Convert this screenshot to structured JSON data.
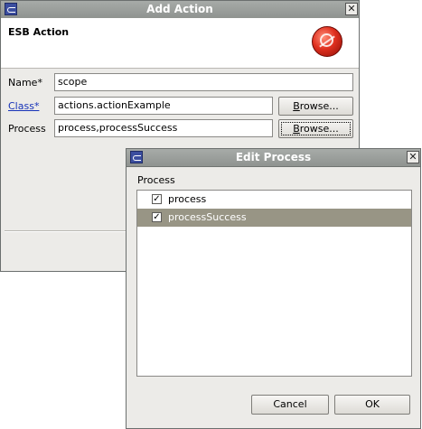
{
  "add_action": {
    "title": "Add Action",
    "close_glyph": "✕",
    "header_title": "ESB Action",
    "fields": {
      "name": {
        "label": "Name*",
        "value": "scope"
      },
      "class": {
        "label": "Class*",
        "value": "actions.actionExample",
        "browse_label": "Browse..."
      },
      "process": {
        "label": "Process",
        "value": "process,processSuccess",
        "browse_label": "Browse..."
      }
    }
  },
  "edit_process": {
    "title": "Edit Process",
    "close_glyph": "✕",
    "section_label": "Process",
    "items": [
      {
        "label": "process",
        "checked": true,
        "selected": false
      },
      {
        "label": "processSuccess",
        "checked": true,
        "selected": true
      }
    ],
    "check_glyph": "✓",
    "cancel_label": "Cancel",
    "ok_label": "OK"
  },
  "colors": {
    "titlebar": "#9a9e9b",
    "selection": "#989585",
    "link": "#1733b8",
    "esb_logo": "#e0301f"
  },
  "icons": [
    "app-icon",
    "close-icon",
    "esb-logo-icon",
    "checkbox-icon"
  ]
}
